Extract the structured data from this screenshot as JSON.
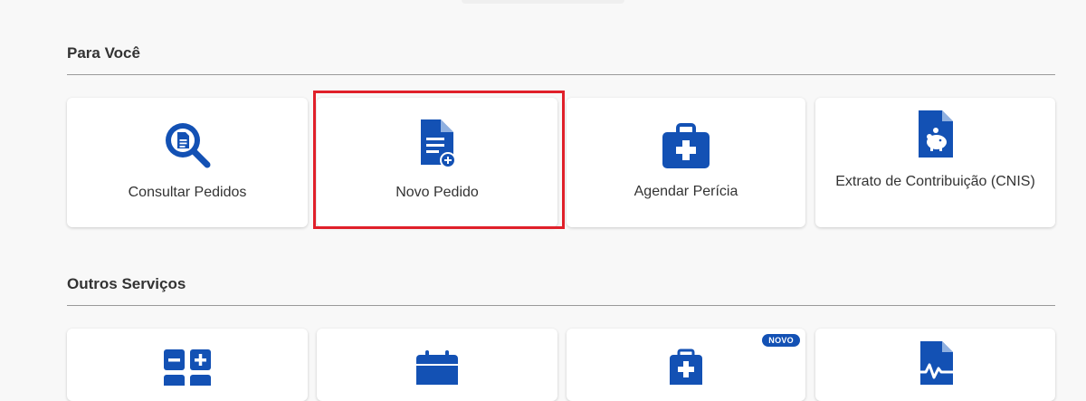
{
  "sections": {
    "para_voce": {
      "title": "Para Você",
      "cards": [
        {
          "label": "Consultar Pedidos",
          "icon": "search-document-icon"
        },
        {
          "label": "Novo Pedido",
          "icon": "new-document-icon"
        },
        {
          "label": "Agendar Perícia",
          "icon": "medical-kit-icon"
        },
        {
          "label": "Extrato de Contribuição (CNIS)",
          "icon": "piggy-bank-document-icon"
        }
      ]
    },
    "outros_servicos": {
      "title": "Outros Serviços",
      "cards": [
        {
          "label": "",
          "icon": "calculator-icon"
        },
        {
          "label": "",
          "icon": "calendar-icon"
        },
        {
          "label": "",
          "icon": "medical-clipboard-icon",
          "badge": "NOVO"
        },
        {
          "label": "",
          "icon": "heartbeat-document-icon"
        }
      ]
    }
  },
  "colors": {
    "icon_blue": "#1351b4",
    "highlight_red": "#e0202a",
    "background": "#f8f8f8"
  }
}
